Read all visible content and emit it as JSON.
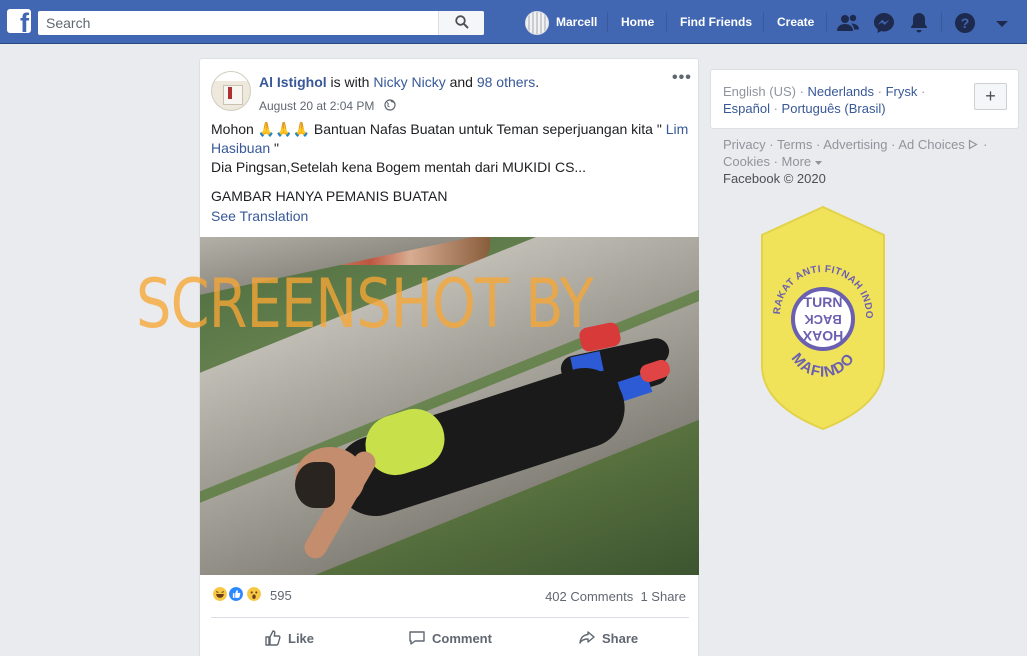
{
  "topbar": {
    "logo": "f",
    "search_placeholder": "Search",
    "user_name": "Marcell",
    "nav": [
      "Home",
      "Find Friends",
      "Create"
    ],
    "icons": [
      "friend-requests-icon",
      "messenger-icon",
      "notifications-icon",
      "help-icon",
      "account-menu-icon"
    ]
  },
  "post": {
    "author": "Al Istighol",
    "with_text": " is with ",
    "tagged": "Nicky Nicky",
    "and_text": " and ",
    "others": "98 others",
    "period": ".",
    "timestamp": "August 20 at 2:04 PM",
    "privacy_icon": "globe-icon",
    "more": "•••",
    "text_line1": "Mohon 🙏🙏🙏 Bantuan Nafas Buatan untuk Teman seperjuangan kita \"",
    "text_link": "Lim Hasibuan",
    "text_quote_end": " \"",
    "text_line2": "Dia Pingsan,Setelah kena Bogem mentah dari MUKIDI CS...",
    "text_line3": "GAMBAR HANYA PEMANIS BUATAN",
    "see_translation": "See Translation",
    "watermark": "SCREENSHOT BY",
    "reaction_count": "595",
    "comments": "402 Comments",
    "shares": "1 Share",
    "actions": {
      "like": "Like",
      "comment": "Comment",
      "share": "Share"
    }
  },
  "sidebar": {
    "current_language": "English (US)",
    "languages": [
      "Nederlands",
      "Frysk",
      "Español",
      "Português (Brasil)"
    ],
    "add_language": "+",
    "footer": [
      "Privacy",
      "Terms",
      "Advertising",
      "Ad Choices",
      "Cookies",
      "More"
    ],
    "copyright": "Facebook © 2020"
  },
  "badge": {
    "top_arc": "MASYARAKAT ANTI FITNAH INDONESIA",
    "center": [
      "TURN",
      "BACK",
      "HOAX"
    ],
    "bottom": "MAFINDO",
    "color": "#f0e35a"
  }
}
